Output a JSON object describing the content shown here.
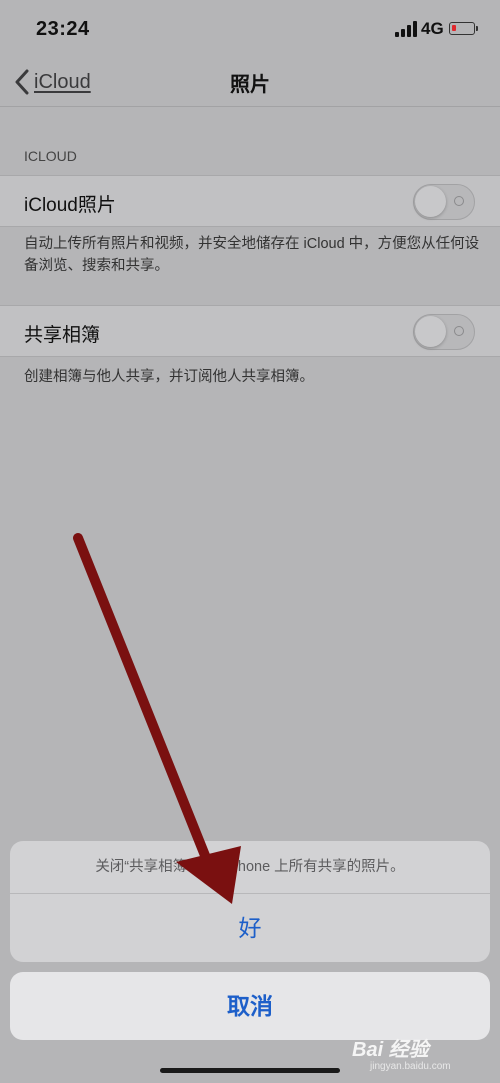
{
  "status_bar": {
    "time": "23:24",
    "network": "4G"
  },
  "nav": {
    "back_label": "iCloud",
    "title": "照片"
  },
  "section": {
    "header": "ICLOUD"
  },
  "settings": [
    {
      "label": "iCloud照片",
      "enabled": false,
      "footer": "自动上传所有照片和视频，并安全地储存在 iCloud 中，方便您从任何设备浏览、搜索和共享。"
    },
    {
      "label": "共享相簿",
      "enabled": false,
      "footer": "创建相簿与他人共享，并订阅他人共享相簿。"
    }
  ],
  "action_sheet": {
    "message": "关闭“共享相簿”将会    iPhone 上所有共享的照片。",
    "confirm_label": "好",
    "cancel_label": "取消"
  },
  "watermark": {
    "text": "Bai 经验",
    "sub": "jingyan.baidu.com"
  },
  "colors": {
    "accent": "#1d5fc9",
    "arrow": "#7a1010",
    "battery_low": "#e0282d"
  }
}
